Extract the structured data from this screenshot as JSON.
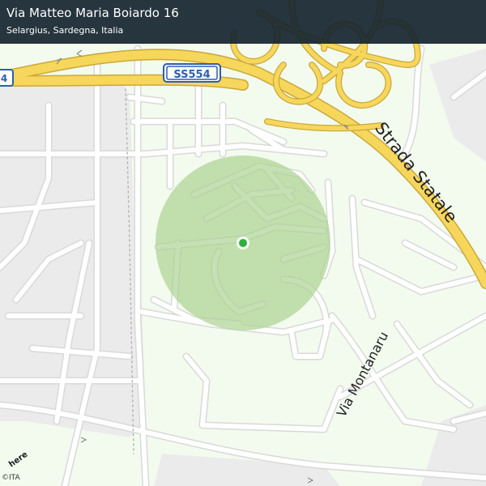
{
  "header": {
    "title": "Via Matteo Maria Boiardo 16",
    "subtitle": "Selargius, Sardegna, Italia"
  },
  "map": {
    "shield_label": "SS554",
    "shield_left_label": "4",
    "highway_label": "Strada Statale",
    "street_label": "Via Montanaru",
    "colors": {
      "background": "#f3fbee",
      "urban_area": "#ebebeb",
      "road": "#ffffff",
      "road_outline": "#d6d6d6",
      "highway": "#f7d65c",
      "highway_outline": "#c9a93a",
      "accuracy_circle": "#a9d18e",
      "location_dot": "#2daf3a",
      "shield_border": "#2b5fb0"
    },
    "icons": [
      "location-dot-icon",
      "direction-arrow-icon"
    ]
  },
  "attribution": {
    "logo": "here",
    "text": "©ITA"
  }
}
